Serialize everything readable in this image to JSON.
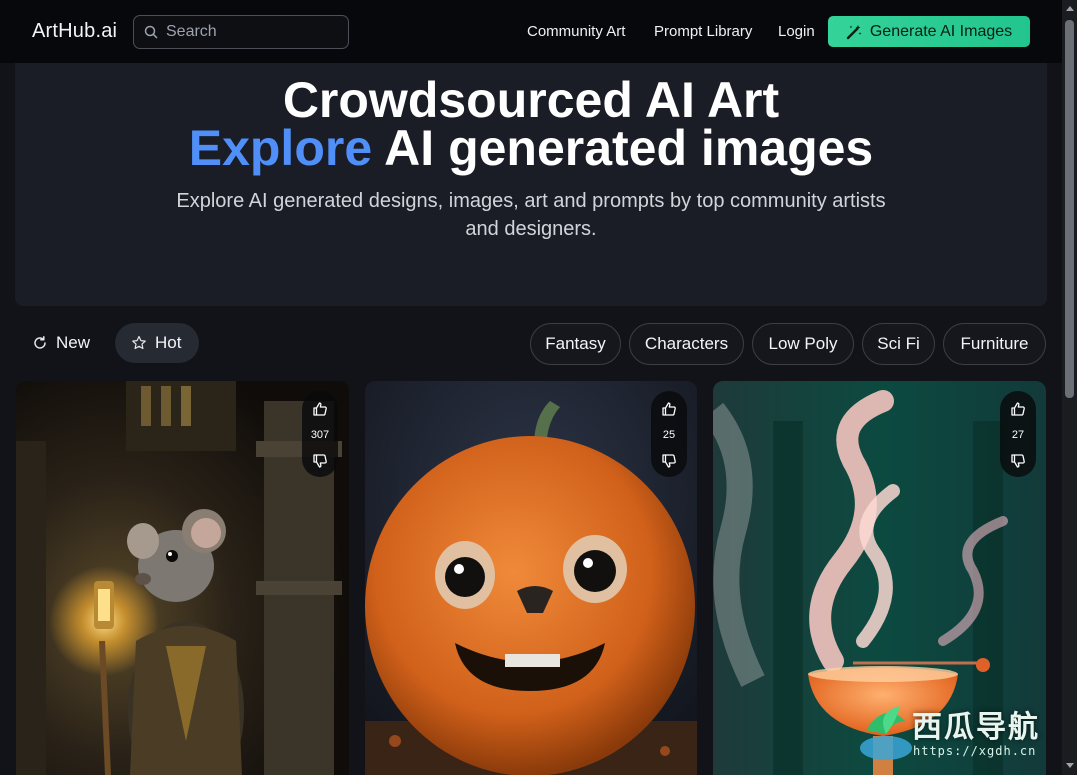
{
  "header": {
    "brand": "ArtHub.ai",
    "search_placeholder": "Search",
    "nav": [
      "Community Art",
      "Prompt Library",
      "Login"
    ],
    "cta_label": "Generate AI Images"
  },
  "hero": {
    "title": "Crowdsourced AI Art",
    "title2_accent": "Explore",
    "title2_rest": " AI generated images",
    "subtitle": "Explore AI generated designs, images, art and prompts by top community artists and designers."
  },
  "sort": {
    "new_label": "New",
    "hot_label": "Hot"
  },
  "categories": [
    "Fantasy",
    "Characters",
    "Low Poly",
    "Sci Fi",
    "Furniture"
  ],
  "cards": [
    {
      "votes": "307",
      "subject": "mouse-with-lantern"
    },
    {
      "votes": "25",
      "subject": "furry-pumpkin"
    },
    {
      "votes": "27",
      "subject": "smoky-cocktail"
    }
  ],
  "watermark": {
    "text": "西瓜导航",
    "url": "https://xgdh.cn"
  },
  "colors": {
    "background": "#111318",
    "hero_bg": "#1a1d26",
    "accent_blue": "#4f8ff7",
    "cta_green": "#34d399"
  }
}
